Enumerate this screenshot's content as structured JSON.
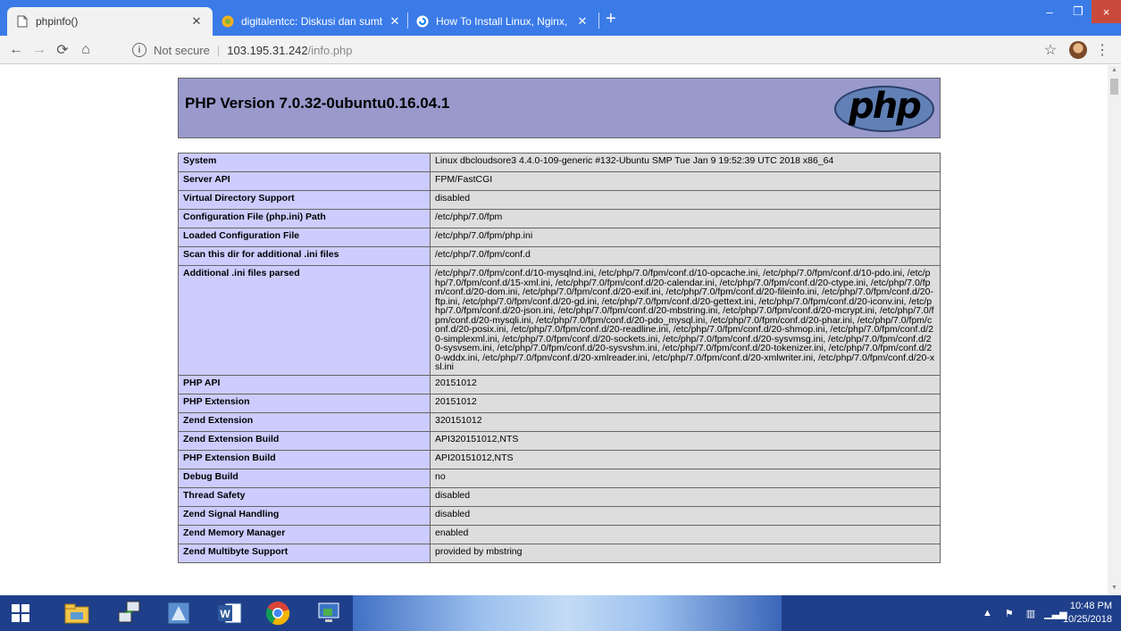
{
  "browser": {
    "tabs": [
      {
        "title": "phpinfo()",
        "active": true,
        "icon": "document-icon"
      },
      {
        "title": "digitalentcc: Diskusi dan sumber",
        "active": false,
        "icon": "digitalentcc-favicon"
      },
      {
        "title": "How To Install Linux, Nginx, MyS",
        "active": false,
        "icon": "digitalocean-favicon"
      }
    ],
    "new_tab_label": "+",
    "window_controls": {
      "minimize": "–",
      "maximize": "❐",
      "close": "×"
    },
    "address": {
      "security_label": "Not secure",
      "host": "103.195.31.242",
      "path": "/info.php"
    }
  },
  "phpinfo": {
    "title": "PHP Version 7.0.32-0ubuntu0.16.04.1",
    "logo_text": "php",
    "rows": [
      {
        "key": "System",
        "value": "Linux dbcloudsore3 4.4.0-109-generic #132-Ubuntu SMP Tue Jan 9 19:52:39 UTC 2018 x86_64"
      },
      {
        "key": "Server API",
        "value": "FPM/FastCGI"
      },
      {
        "key": "Virtual Directory Support",
        "value": "disabled"
      },
      {
        "key": "Configuration File (php.ini) Path",
        "value": "/etc/php/7.0/fpm"
      },
      {
        "key": "Loaded Configuration File",
        "value": "/etc/php/7.0/fpm/php.ini"
      },
      {
        "key": "Scan this dir for additional .ini files",
        "value": "/etc/php/7.0/fpm/conf.d"
      },
      {
        "key": "Additional .ini files parsed",
        "value": "/etc/php/7.0/fpm/conf.d/10-mysqlnd.ini, /etc/php/7.0/fpm/conf.d/10-opcache.ini, /etc/php/7.0/fpm/conf.d/10-pdo.ini, /etc/php/7.0/fpm/conf.d/15-xml.ini, /etc/php/7.0/fpm/conf.d/20-calendar.ini, /etc/php/7.0/fpm/conf.d/20-ctype.ini, /etc/php/7.0/fpm/conf.d/20-dom.ini, /etc/php/7.0/fpm/conf.d/20-exif.ini, /etc/php/7.0/fpm/conf.d/20-fileinfo.ini, /etc/php/7.0/fpm/conf.d/20-ftp.ini, /etc/php/7.0/fpm/conf.d/20-gd.ini, /etc/php/7.0/fpm/conf.d/20-gettext.ini, /etc/php/7.0/fpm/conf.d/20-iconv.ini, /etc/php/7.0/fpm/conf.d/20-json.ini, /etc/php/7.0/fpm/conf.d/20-mbstring.ini, /etc/php/7.0/fpm/conf.d/20-mcrypt.ini, /etc/php/7.0/fpm/conf.d/20-mysqli.ini, /etc/php/7.0/fpm/conf.d/20-pdo_mysql.ini, /etc/php/7.0/fpm/conf.d/20-phar.ini, /etc/php/7.0/fpm/conf.d/20-posix.ini, /etc/php/7.0/fpm/conf.d/20-readline.ini, /etc/php/7.0/fpm/conf.d/20-shmop.ini, /etc/php/7.0/fpm/conf.d/20-simplexml.ini, /etc/php/7.0/fpm/conf.d/20-sockets.ini, /etc/php/7.0/fpm/conf.d/20-sysvmsg.ini, /etc/php/7.0/fpm/conf.d/20-sysvsem.ini, /etc/php/7.0/fpm/conf.d/20-sysvshm.ini, /etc/php/7.0/fpm/conf.d/20-tokenizer.ini, /etc/php/7.0/fpm/conf.d/20-wddx.ini, /etc/php/7.0/fpm/conf.d/20-xmlreader.ini, /etc/php/7.0/fpm/conf.d/20-xmlwriter.ini, /etc/php/7.0/fpm/conf.d/20-xsl.ini"
      },
      {
        "key": "PHP API",
        "value": "20151012"
      },
      {
        "key": "PHP Extension",
        "value": "20151012"
      },
      {
        "key": "Zend Extension",
        "value": "320151012"
      },
      {
        "key": "Zend Extension Build",
        "value": "API320151012,NTS"
      },
      {
        "key": "PHP Extension Build",
        "value": "API20151012,NTS"
      },
      {
        "key": "Debug Build",
        "value": "no"
      },
      {
        "key": "Thread Safety",
        "value": "disabled"
      },
      {
        "key": "Zend Signal Handling",
        "value": "disabled"
      },
      {
        "key": "Zend Memory Manager",
        "value": "enabled"
      },
      {
        "key": "Zend Multibyte Support",
        "value": "provided by mbstring"
      }
    ]
  },
  "taskbar": {
    "apps": [
      "start-icon",
      "file-explorer-icon",
      "network-app-icon",
      "app-icon",
      "word-icon",
      "chrome-icon",
      "remote-desktop-icon"
    ],
    "time": "10:48 PM",
    "date": "10/25/2018"
  },
  "colors": {
    "chrome_tabstrip": "#3b7be8",
    "php_header": "#9999cc",
    "php_key_cell": "#ccccff",
    "php_value_cell": "#dddddd",
    "taskbar": "#1f3f8a"
  }
}
